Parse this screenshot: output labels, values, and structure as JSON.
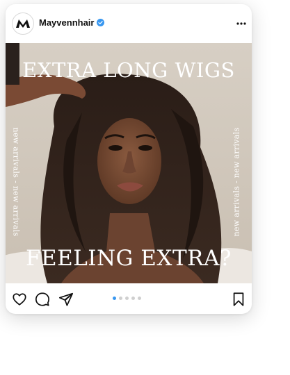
{
  "post": {
    "username": "Mayvennhair",
    "verified": true,
    "avatar_logo": "M",
    "more_icon": "ellipsis-horizontal-icon",
    "image": {
      "headline_top": "EXTRA LONG WIGS",
      "headline_bottom": "FEELING EXTRA?",
      "side_text_left": "new arrivals - new arrivals",
      "side_text_right": "new arrivals - new arrivals"
    },
    "actions": {
      "like_icon": "heart-icon",
      "comment_icon": "comment-icon",
      "share_icon": "send-icon",
      "save_icon": "bookmark-icon"
    },
    "carousel": {
      "total": 5,
      "active_index": 0
    },
    "colors": {
      "accent": "#3897f0",
      "verified_badge": "#3897f0",
      "text": "#111111"
    }
  }
}
